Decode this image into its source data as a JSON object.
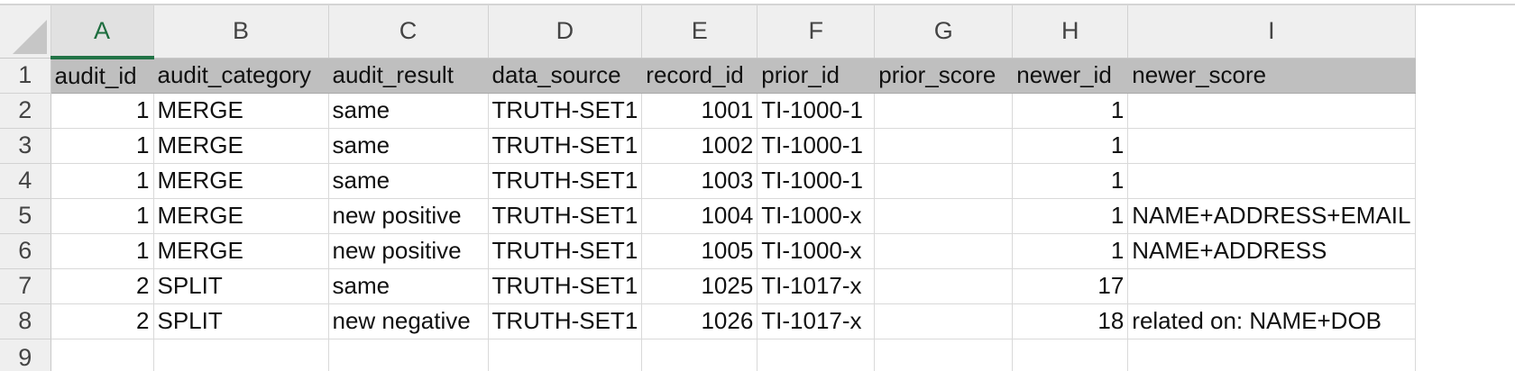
{
  "columns": [
    "A",
    "B",
    "C",
    "D",
    "E",
    "F",
    "G",
    "H",
    "I"
  ],
  "row_numbers": [
    "1",
    "2",
    "3",
    "4",
    "5",
    "6",
    "7",
    "8",
    "9"
  ],
  "active_column": "A",
  "header_row": [
    "audit_id",
    "audit_category",
    "audit_result",
    "data_source",
    "record_id",
    "prior_id",
    "prior_score",
    "newer_id",
    "newer_score"
  ],
  "rows": [
    [
      "1",
      "MERGE",
      "same",
      "TRUTH-SET1",
      "1001",
      "TI-1000-1",
      "",
      "1",
      ""
    ],
    [
      "1",
      "MERGE",
      "same",
      "TRUTH-SET1",
      "1002",
      "TI-1000-1",
      "",
      "1",
      ""
    ],
    [
      "1",
      "MERGE",
      "same",
      "TRUTH-SET1",
      "1003",
      "TI-1000-1",
      "",
      "1",
      ""
    ],
    [
      "1",
      "MERGE",
      "new positive",
      "TRUTH-SET1",
      "1004",
      "TI-1000-x",
      "",
      "1",
      "NAME+ADDRESS+EMAIL"
    ],
    [
      "1",
      "MERGE",
      "new positive",
      "TRUTH-SET1",
      "1005",
      "TI-1000-x",
      "",
      "1",
      "NAME+ADDRESS"
    ],
    [
      "2",
      "SPLIT",
      "same",
      "TRUTH-SET1",
      "1025",
      "TI-1017-x",
      "",
      "17",
      ""
    ],
    [
      "2",
      "SPLIT",
      "new negative",
      "TRUTH-SET1",
      "1026",
      "TI-1017-x",
      "",
      "18",
      "related on: NAME+DOB"
    ]
  ],
  "colors": {
    "header_fill": "#bfbfbf",
    "active_column_accent": "#217346",
    "gridline": "#d9d9d9"
  }
}
